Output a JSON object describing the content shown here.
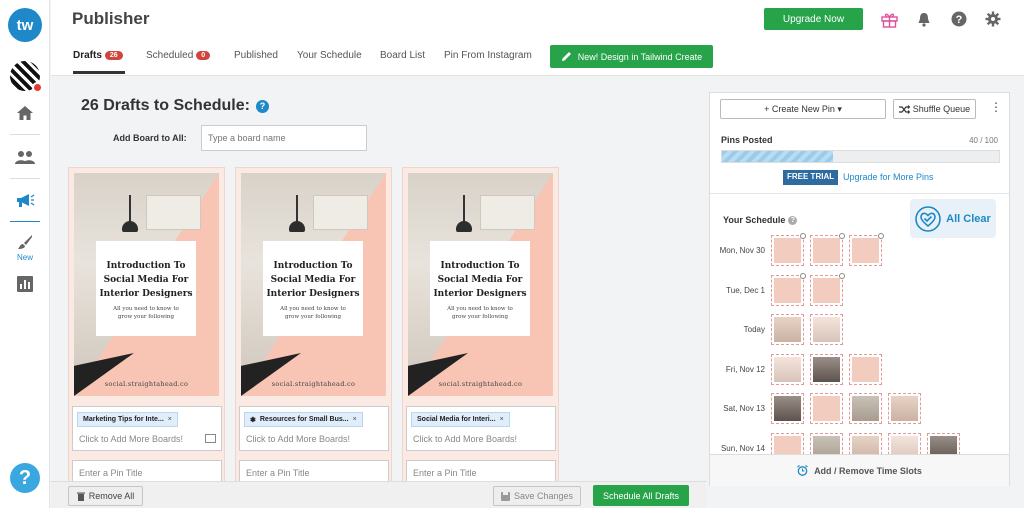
{
  "app": {
    "logo_text": "tw",
    "title": "Publisher",
    "upgrade_label": "Upgrade Now",
    "new_label": "New",
    "help_label": "?"
  },
  "tabs": [
    {
      "label": "Drafts",
      "badge": "26"
    },
    {
      "label": "Scheduled",
      "badge": "0"
    },
    {
      "label": "Published"
    },
    {
      "label": "Your Schedule"
    },
    {
      "label": "Board List"
    },
    {
      "label": "Pin From Instagram"
    }
  ],
  "create_button_label": "New! Design in Tailwind Create",
  "main": {
    "title": "26 Drafts to Schedule:",
    "add_board_label": "Add Board to All:",
    "add_board_placeholder": "Type a board name"
  },
  "drafts": [
    {
      "pin_title": "Introduction To Social Media For Interior Designers",
      "pin_subtitle": "All you need to know to grow your following",
      "pin_url": "social.straightahead.co",
      "board_chip": "Marketing Tips for Inte...",
      "chip_icon": "",
      "more_boards_placeholder": "Click to Add More Boards!",
      "title_placeholder": "Enter a Pin Title"
    },
    {
      "pin_title": "Introduction To Social Media For Interior Designers",
      "pin_subtitle": "All you need to know to grow your following",
      "pin_url": "social.straightahead.co",
      "board_chip": "Resources for Small Bus...",
      "chip_icon": "❃",
      "more_boards_placeholder": "Click to Add More Boards!",
      "title_placeholder": "Enter a Pin Title"
    },
    {
      "pin_title": "Introduction To Social Media For Interior Designers",
      "pin_subtitle": "All you need to know to grow your following",
      "pin_url": "social.straightahead.co",
      "board_chip": "Social Media for Interi...",
      "chip_icon": "",
      "more_boards_placeholder": "Click to Add More Boards!",
      "title_placeholder": "Enter a Pin Title"
    }
  ],
  "bottom_bar": {
    "remove_all": "Remove All",
    "save_changes": "Save Changes",
    "schedule_all": "Schedule All Drafts"
  },
  "panel": {
    "create_new_pin": "Create New Pin",
    "shuffle_queue": "Shuffle Queue",
    "pins_posted_label": "Pins Posted",
    "pins_posted_count": "40 / 100",
    "pins_posted_fraction": 0.4,
    "free_trial": "FREE TRIAL",
    "upgrade_more": "Upgrade for More Pins",
    "your_schedule": "Your Schedule",
    "all_clear": "All Clear",
    "time_slots": "Add / Remove Time Slots",
    "days": [
      {
        "label": "Mon, Nov 30",
        "slots": 3
      },
      {
        "label": "Tue, Dec 1",
        "slots": 2
      },
      {
        "label": "Today",
        "slots": 2
      },
      {
        "label": "Fri, Nov 12",
        "slots": 3
      },
      {
        "label": "Sat, Nov 13",
        "slots": 4
      },
      {
        "label": "Sun, Nov 14",
        "slots": 5
      }
    ]
  },
  "colors": {
    "brand_blue": "#1e88c9",
    "green": "#27a34a",
    "badge_red": "#d0453f",
    "pin_pink": "#f8c4b4"
  }
}
